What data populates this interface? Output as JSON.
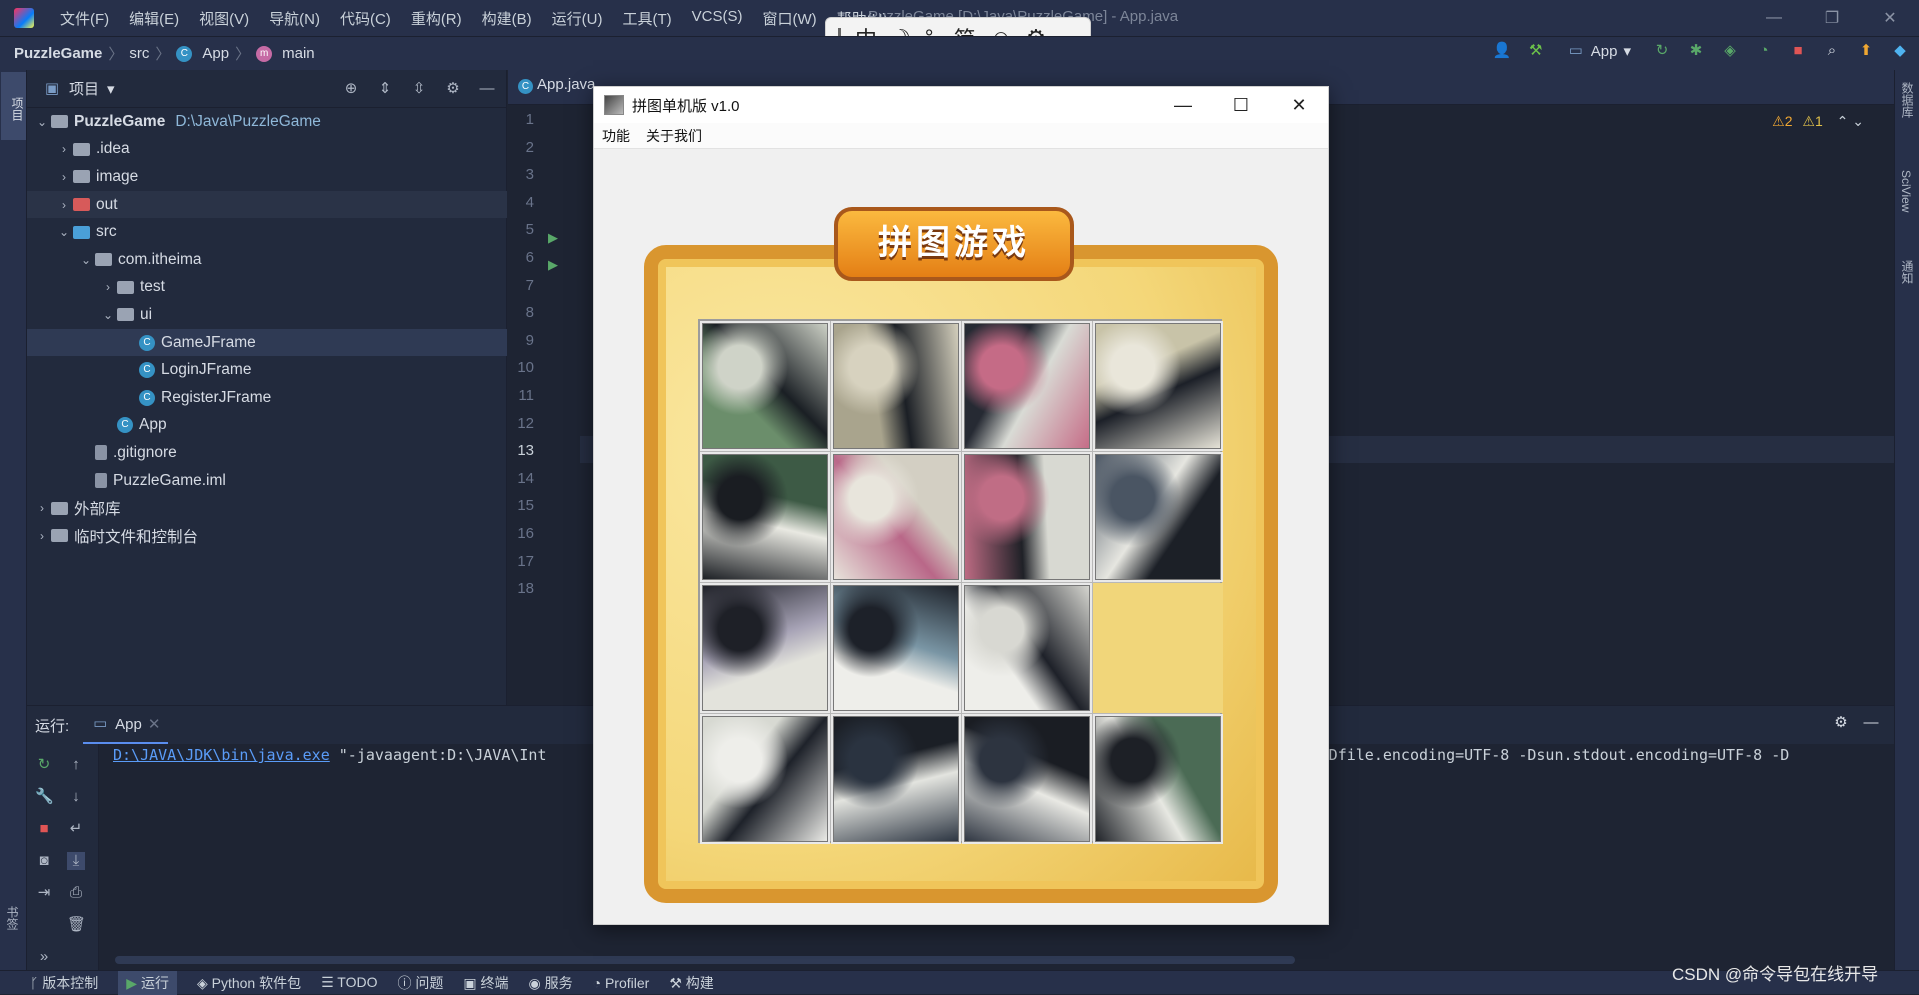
{
  "titlebar": {
    "menus": [
      "文件(F)",
      "编辑(E)",
      "视图(V)",
      "导航(N)",
      "代码(C)",
      "重构(R)",
      "构建(B)",
      "运行(U)",
      "工具(T)",
      "VCS(S)",
      "窗口(W)",
      "帮助(H)"
    ],
    "window_title": "PuzzleGame [D:\\Java\\PuzzleGame] - App.java"
  },
  "ime": {
    "items": [
      "中",
      "☽",
      "°,",
      "简",
      "☺",
      "⚙"
    ]
  },
  "navbar": {
    "project": "PuzzleGame",
    "folder": "src",
    "file": "App",
    "method": "main",
    "run_config": "App"
  },
  "leftstrip": {
    "project_label": "项目",
    "bookmarks_label": "书签",
    "structure_label": "结构"
  },
  "rightstrip": {
    "labels": [
      "数据库",
      "SciView",
      "通知"
    ]
  },
  "project_panel": {
    "title": "项目",
    "tree": [
      {
        "label": "PuzzleGame",
        "path": "D:\\Java\\PuzzleGame",
        "type": "module",
        "expanded": true
      },
      {
        "label": ".idea",
        "type": "folder"
      },
      {
        "label": "image",
        "type": "folder"
      },
      {
        "label": "out",
        "type": "folder-excluded"
      },
      {
        "label": "src",
        "type": "folder-source",
        "expanded": true
      },
      {
        "label": "com.itheima",
        "type": "package",
        "expanded": true
      },
      {
        "label": "test",
        "type": "package"
      },
      {
        "label": "ui",
        "type": "package",
        "expanded": true
      },
      {
        "label": "GameJFrame",
        "type": "class"
      },
      {
        "label": "LoginJFrame",
        "type": "class"
      },
      {
        "label": "RegisterJFrame",
        "type": "class"
      },
      {
        "label": "App",
        "type": "class"
      },
      {
        "label": ".gitignore",
        "type": "file"
      },
      {
        "label": "PuzzleGame.iml",
        "type": "file"
      },
      {
        "label": "外部库",
        "type": "library"
      },
      {
        "label": "临时文件和控制台",
        "type": "scratch"
      }
    ]
  },
  "editor": {
    "tab": "App.java",
    "line_numbers": [
      "1",
      "2",
      "3",
      "4",
      "5",
      "6",
      "7",
      "8",
      "9",
      "10",
      "11",
      "12",
      "13",
      "14",
      "15",
      "16",
      "17",
      "18"
    ],
    "warnings": "⚠2",
    "weak_warnings": "⚠1",
    "current_line": 13
  },
  "run_panel": {
    "label": "运行:",
    "tab": "App",
    "console_link": "D:\\JAVA\\JDK\\bin\\java.exe",
    "console_rest": " \"-javaagent:D:\\JAVA\\Int",
    "console_tail": "bin\" -Dfile.encoding=UTF-8 -Dsun.stdout.encoding=UTF-8 -D"
  },
  "status_bar": {
    "items": [
      "版本控制",
      "运行",
      "Python 软件包",
      "TODO",
      "问题",
      "终端",
      "服务",
      "Profiler",
      "构建"
    ]
  },
  "watermark": "CSDN @命令导包在线开导",
  "game_window": {
    "title": "拼图单机版 v1.0",
    "menus": [
      "功能",
      "关于我们"
    ],
    "banner": "拼图游戏",
    "tiles": [
      {
        "colors": [
          "#6b8e6b",
          "#1a1f24",
          "#cfd3c8"
        ]
      },
      {
        "colors": [
          "#a9a48d",
          "#1b1f25",
          "#d7d2bf"
        ]
      },
      {
        "colors": [
          "#262a33",
          "#d9dbd5",
          "#c56b86"
        ]
      },
      {
        "colors": [
          "#c8c3a8",
          "#1c2028",
          "#e9e6da"
        ]
      },
      {
        "colors": [
          "#3d5a45",
          "#e9e9e2",
          "#1a1d22"
        ]
      },
      {
        "colors": [
          "#d3cfc3",
          "#b96788",
          "#e8e5dc"
        ]
      },
      {
        "colors": [
          "#d8d9d2",
          "#1f2127",
          "#c06d85"
        ]
      },
      {
        "colors": [
          "#1c2027",
          "#e6e6e0",
          "#4a5563"
        ]
      },
      {
        "colors": [
          "#e3e3dc",
          "#a7a3b6",
          "#1e2027"
        ]
      },
      {
        "colors": [
          "#eeeeea",
          "#7a96a5",
          "#1d2129"
        ]
      },
      {
        "colors": [
          "#eeeeea",
          "#1e2129",
          "#d8d8d2"
        ]
      },
      {
        "colors": "empty"
      },
      {
        "colors": [
          "#d7d9d2",
          "#1e222a",
          "#eeeeea"
        ]
      },
      {
        "colors": [
          "#1b1f26",
          "#e3e4df",
          "#2a3340"
        ]
      },
      {
        "colors": [
          "#1a1d23",
          "#e9e9e4",
          "#2d3440"
        ]
      },
      {
        "colors": [
          "#4b6b55",
          "#e7e8e2",
          "#1d2026"
        ]
      }
    ]
  }
}
